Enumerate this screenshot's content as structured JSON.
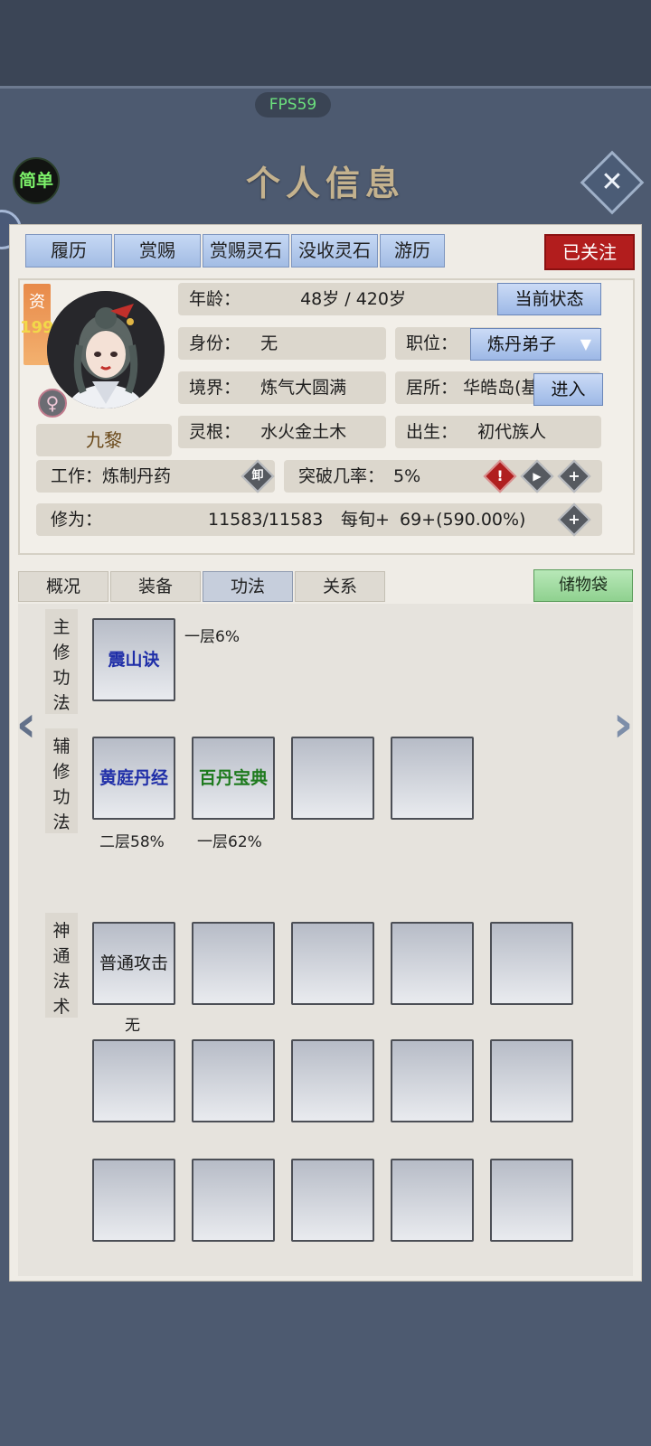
{
  "fps": "FPS59",
  "header": {
    "simple_label": "简单",
    "title": "个人信息"
  },
  "top_tabs": [
    {
      "label": "履历"
    },
    {
      "label": "赏赐"
    },
    {
      "label": "赏赐灵石"
    },
    {
      "label": "没收灵石"
    },
    {
      "label": "游历"
    }
  ],
  "follow_label": "已关注",
  "character": {
    "aptitude_label": "资",
    "aptitude_value": "199",
    "gender_symbol": "♀",
    "name": "九黎",
    "age_label": "年龄：",
    "age_value": "48岁 / 420岁",
    "status_button": "当前状态",
    "identity_label": "身份：",
    "identity_value": "无",
    "position_label": "职位：",
    "position_value": "炼丹弟子",
    "realm_label": "境界：",
    "realm_value": "炼气大圆满",
    "residence_label": "居所：",
    "residence_value": "华皓岛(基",
    "enter_button": "进入",
    "root_label": "灵根：",
    "root_value": "水火金土木",
    "birth_label": "出生：",
    "birth_value": "初代族人",
    "work_label": "工作：",
    "work_value": "炼制丹药",
    "unload_label": "卸",
    "breakthrough_label": "突破几率：",
    "breakthrough_value": "5%",
    "cultivation_label": "修为：",
    "cultivation_value": "11583/11583",
    "per_turn_label": "每旬+",
    "per_turn_value": "69+(590.00%)"
  },
  "mid_tabs": [
    {
      "label": "概况",
      "active": false
    },
    {
      "label": "装备",
      "active": false
    },
    {
      "label": "功法",
      "active": true
    },
    {
      "label": "关系",
      "active": false
    }
  ],
  "bag_label": "储物袋",
  "main_method": {
    "section_label": "主修功法",
    "skill_name": "震山诀",
    "level": "一层6%"
  },
  "aux_methods": {
    "section_label": "辅修功法",
    "items": [
      {
        "name": "黄庭丹经",
        "level": "二层58%"
      },
      {
        "name": "百丹宝典",
        "level": "一层62%"
      }
    ]
  },
  "spells": {
    "section_label": "神通法术",
    "first_name": "普通攻击",
    "first_level": "无"
  },
  "icons": {
    "close": "close-icon",
    "alert": "alert-icon",
    "play": "play-icon",
    "plus": "plus-icon",
    "left_arrow": "chevron-left-icon",
    "right_arrow": "chevron-right-icon"
  },
  "colors": {
    "follow_red": "#b21d1d",
    "tab_blue": "#a2bce4",
    "bag_green": "#8fd18f",
    "skill_blue_text": "#1f2ea8",
    "skill_green_text": "#1d7a1d"
  }
}
